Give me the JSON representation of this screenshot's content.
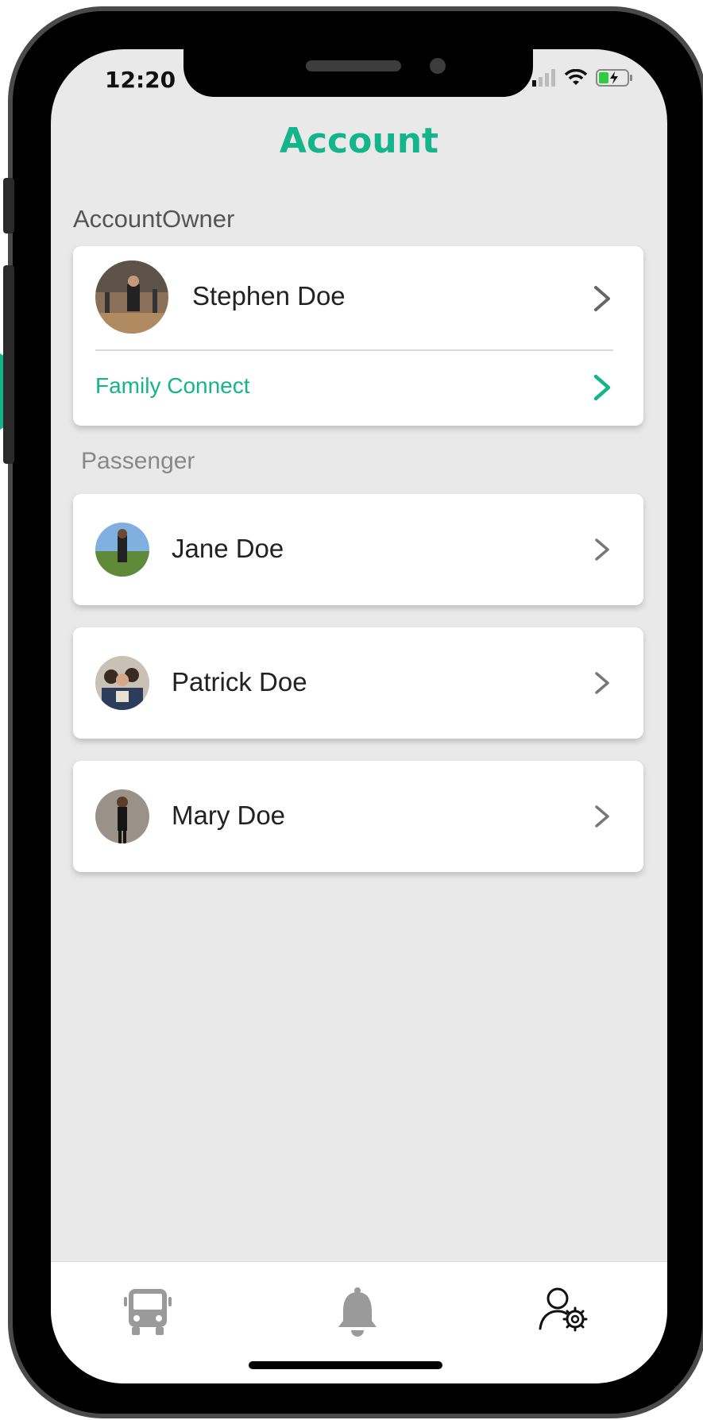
{
  "status": {
    "time": "12:20"
  },
  "header": {
    "title": "Account"
  },
  "account_owner": {
    "section_label": "AccountOwner",
    "name": "Stephen Doe",
    "family_connect_label": "Family Connect"
  },
  "passengers": {
    "section_label": "Passenger",
    "items": [
      {
        "name": "Jane Doe"
      },
      {
        "name": "Patrick Doe"
      },
      {
        "name": "Mary Doe"
      }
    ]
  },
  "tab_bar": {
    "tabs": [
      {
        "icon": "bus-icon",
        "active": false
      },
      {
        "icon": "bell-icon",
        "active": false
      },
      {
        "icon": "user-settings-icon",
        "active": true
      }
    ]
  },
  "colors": {
    "accent": "#14b58b",
    "background": "#e9e9e9"
  }
}
